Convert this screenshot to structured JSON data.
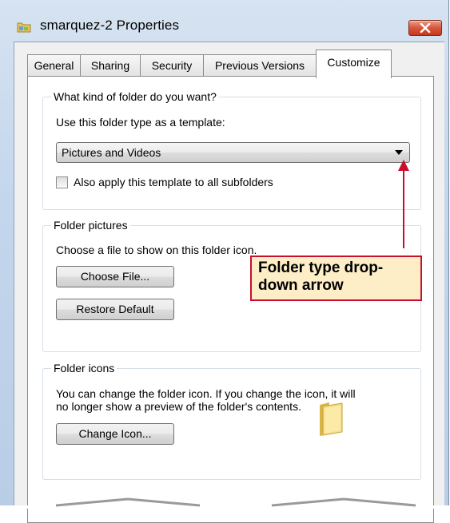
{
  "window": {
    "title": "smarquez-2 Properties"
  },
  "tabs": [
    {
      "label": "General"
    },
    {
      "label": "Sharing"
    },
    {
      "label": "Security"
    },
    {
      "label": "Previous Versions"
    },
    {
      "label": "Customize"
    }
  ],
  "active_tab": "Customize",
  "folder_type_group": {
    "legend": "What kind of folder do you want?",
    "template_label": "Use this folder type as a template:",
    "selected_type": "Pictures and Videos",
    "apply_checkbox_label": "Also apply this template to all subfolders",
    "apply_checked": false
  },
  "folder_pictures_group": {
    "legend": "Folder pictures",
    "description": "Choose a file to show on this folder icon.",
    "choose_file_label": "Choose File...",
    "restore_default_label": "Restore Default"
  },
  "folder_icons_group": {
    "legend": "Folder icons",
    "description_line1": "You can change the folder icon. If you change the icon, it will",
    "description_line2": "no longer show a preview of the folder's contents.",
    "change_icon_label": "Change Icon..."
  },
  "callout": {
    "line1": "Folder type drop-",
    "line2": "down arrow",
    "color": "#c8102e",
    "fill": "#fdeec8"
  },
  "icons": [
    "folder-title-icon",
    "close-icon",
    "dropdown-arrow-icon",
    "folder-icon"
  ]
}
